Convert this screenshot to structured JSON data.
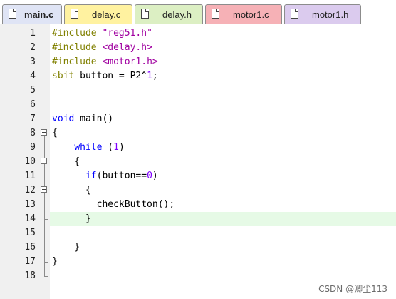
{
  "tabs": [
    {
      "label": "main.c",
      "bg": "#dfe4f5",
      "active": true
    },
    {
      "label": "delay.c",
      "bg": "#fff2a0",
      "active": false
    },
    {
      "label": "delay.h",
      "bg": "#dcefc3",
      "active": false
    },
    {
      "label": "motor1.c",
      "bg": "#f6b1b6",
      "active": false
    },
    {
      "label": "motor1.h",
      "bg": "#dbcbee",
      "active": false
    }
  ],
  "editor": {
    "current_line": 14,
    "lines": [
      {
        "n": "1",
        "tokens": [
          {
            "t": "#include ",
            "c": "k-pre"
          },
          {
            "t": "\"reg51.h\"",
            "c": "k-str"
          }
        ]
      },
      {
        "n": "2",
        "tokens": [
          {
            "t": "#include ",
            "c": "k-pre"
          },
          {
            "t": "<delay.h>",
            "c": "k-str"
          }
        ]
      },
      {
        "n": "3",
        "tokens": [
          {
            "t": "#include ",
            "c": "k-pre"
          },
          {
            "t": "<motor1.h>",
            "c": "k-str"
          }
        ]
      },
      {
        "n": "4",
        "tokens": [
          {
            "t": "sbit",
            "c": "k-pre"
          },
          {
            "t": " button = P2^",
            "c": "k-plain"
          },
          {
            "t": "1",
            "c": "k-num"
          },
          {
            "t": ";",
            "c": "k-plain"
          }
        ]
      },
      {
        "n": "5",
        "tokens": []
      },
      {
        "n": "6",
        "tokens": []
      },
      {
        "n": "7",
        "tokens": [
          {
            "t": "void",
            "c": "k-type"
          },
          {
            "t": " main()",
            "c": "k-plain"
          }
        ]
      },
      {
        "n": "8",
        "tokens": [
          {
            "t": "{",
            "c": "k-plain"
          }
        ]
      },
      {
        "n": "9",
        "tokens": [
          {
            "t": "    ",
            "c": "k-plain"
          },
          {
            "t": "while",
            "c": "k-kw"
          },
          {
            "t": " (",
            "c": "k-plain"
          },
          {
            "t": "1",
            "c": "k-num"
          },
          {
            "t": ")",
            "c": "k-plain"
          }
        ]
      },
      {
        "n": "10",
        "tokens": [
          {
            "t": "    {",
            "c": "k-plain"
          }
        ]
      },
      {
        "n": "11",
        "tokens": [
          {
            "t": "      ",
            "c": "k-plain"
          },
          {
            "t": "if",
            "c": "k-kw"
          },
          {
            "t": "(button==",
            "c": "k-plain"
          },
          {
            "t": "0",
            "c": "k-num"
          },
          {
            "t": ")",
            "c": "k-plain"
          }
        ]
      },
      {
        "n": "12",
        "tokens": [
          {
            "t": "      {",
            "c": "k-plain"
          }
        ]
      },
      {
        "n": "13",
        "tokens": [
          {
            "t": "        checkButton();",
            "c": "k-plain"
          }
        ]
      },
      {
        "n": "14",
        "tokens": [
          {
            "t": "      }",
            "c": "k-plain"
          }
        ]
      },
      {
        "n": "15",
        "tokens": []
      },
      {
        "n": "16",
        "tokens": [
          {
            "t": "    }",
            "c": "k-plain"
          }
        ]
      },
      {
        "n": "17",
        "tokens": [
          {
            "t": "}",
            "c": "k-plain"
          }
        ]
      },
      {
        "n": "18",
        "tokens": []
      }
    ]
  },
  "watermark": "CSDN @卿尘113"
}
